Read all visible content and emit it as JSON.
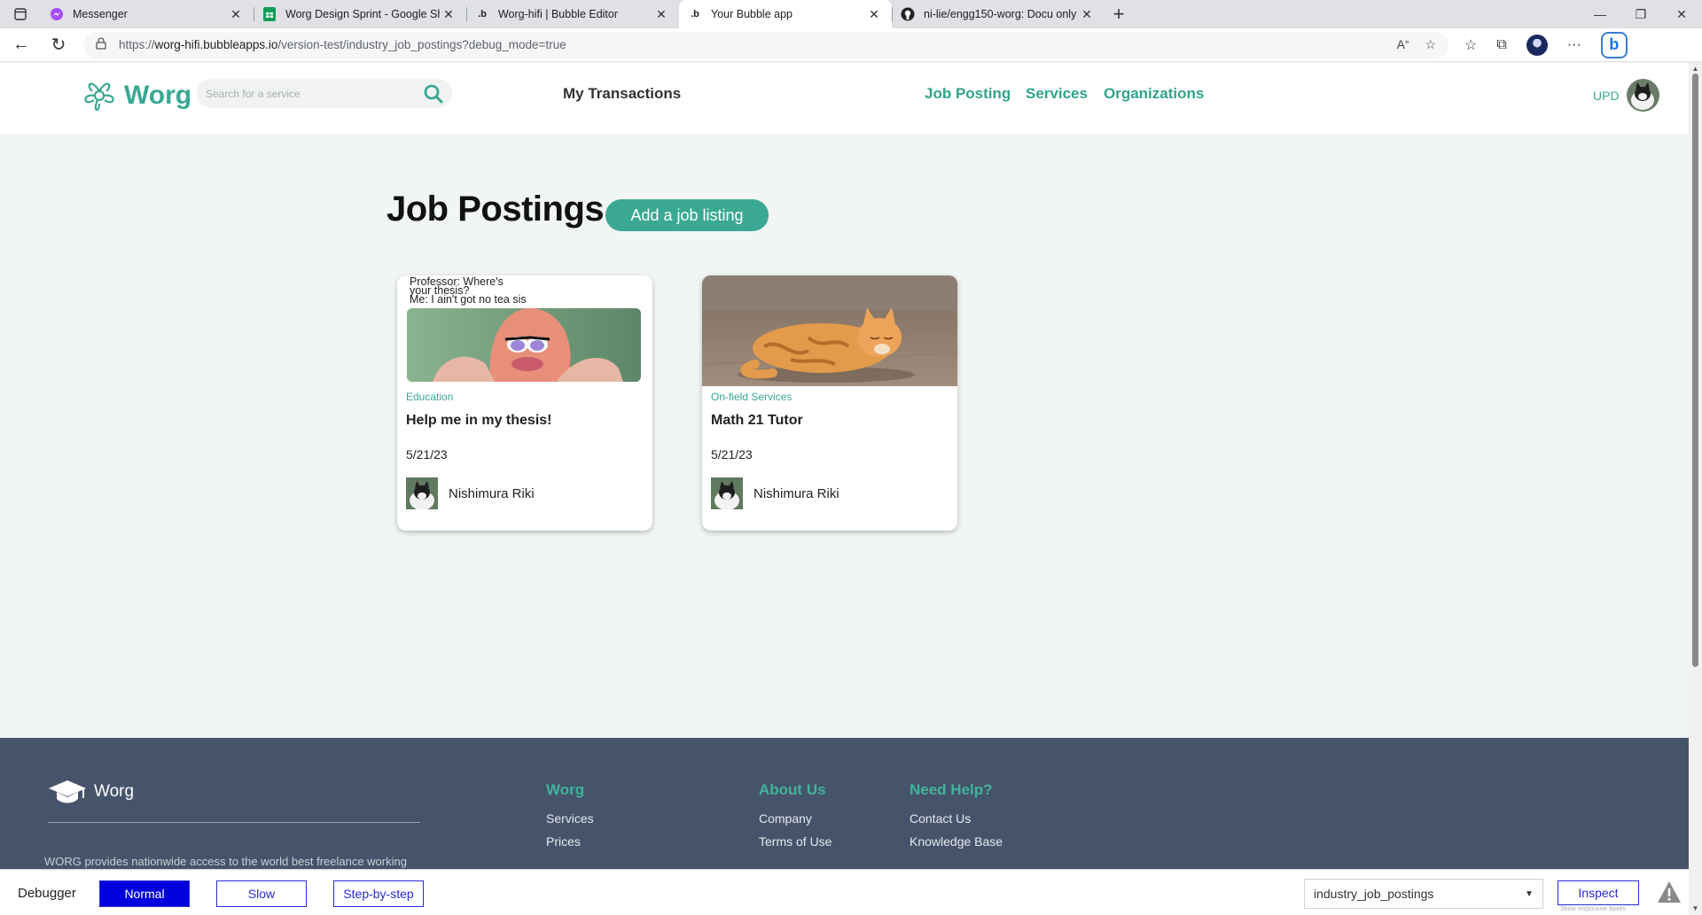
{
  "browser": {
    "tabs": [
      {
        "title": "Messenger",
        "icon": "messenger-icon"
      },
      {
        "title": "Worg Design Sprint - Google Sheets",
        "icon": "google-sheets-icon"
      },
      {
        "title": "Worg-hifi | Bubble Editor",
        "icon": "bubble-icon"
      },
      {
        "title": "Your Bubble app",
        "icon": "bubble-icon",
        "active": true
      },
      {
        "title": "ni-lie/engg150-worg: Docu only",
        "icon": "github-icon"
      }
    ],
    "url_prefix": "https://",
    "url_host": "worg-hifi.bubbleapps.io",
    "url_path": "/version-test/industry_job_postings?debug_mode=true"
  },
  "header": {
    "brand": "Worg",
    "search_placeholder": "Search for a service",
    "my_transactions": "My Transactions",
    "nav": [
      "Job Posting",
      "Services",
      "Organizations"
    ],
    "user": "UPD"
  },
  "main": {
    "title": "Job Postings",
    "add_button": "Add a job listing",
    "cards": [
      {
        "meme_line1": "Professor: Where's",
        "meme_line2": "your thesis?",
        "meme_line3": "Me: I ain't got no tea sis",
        "category": "Education",
        "title": "Help me in my thesis!",
        "date": "5/21/23",
        "author": "Nishimura Riki"
      },
      {
        "category": "On-field Services",
        "title": "Math 21 Tutor",
        "date": "5/21/23",
        "author": "Nishimura Riki"
      }
    ]
  },
  "footer": {
    "brand": "Worg",
    "description": "WORG provides nationwide access to the world best freelance working",
    "columns": [
      {
        "heading": "Worg",
        "links": [
          "Services",
          "Prices"
        ]
      },
      {
        "heading": "About Us",
        "links": [
          "Company",
          "Terms of Use"
        ]
      },
      {
        "heading": "Need Help?",
        "links": [
          "Contact Us",
          "Knowledge Base"
        ]
      }
    ]
  },
  "debugger": {
    "label": "Debugger",
    "modes": [
      "Normal",
      "Slow",
      "Step-by-step"
    ],
    "active_mode": "Normal",
    "page_select": "industry_job_postings",
    "inspect": "Inspect",
    "hint": "Show responsive boxes"
  },
  "colors": {
    "accent": "#3aa893",
    "footer_bg": "#46546b",
    "debug_blue": "#0000dd"
  }
}
